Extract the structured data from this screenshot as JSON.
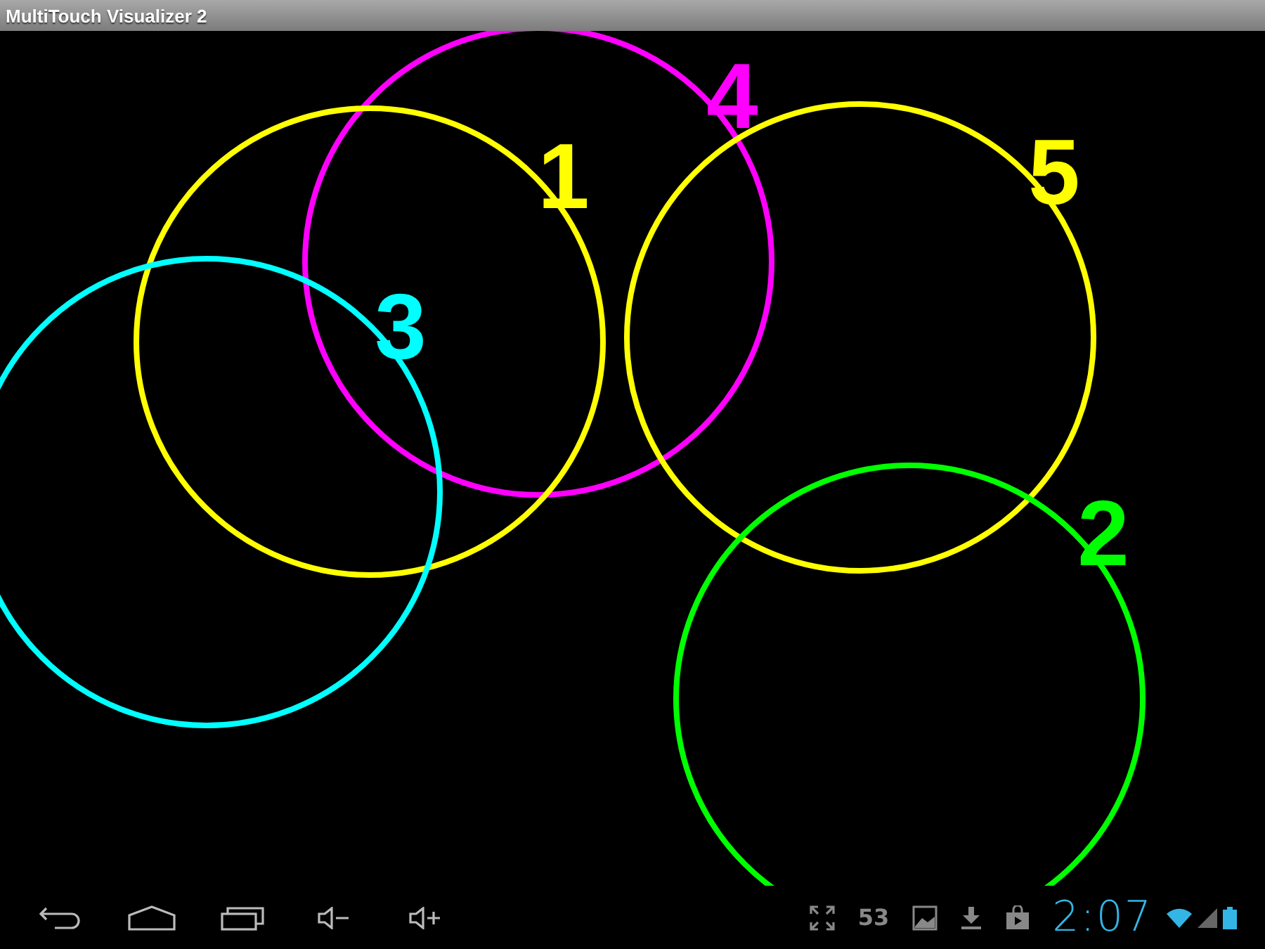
{
  "window": {
    "title": "MultiTouch Visualizer 2"
  },
  "touches": [
    {
      "label": "4",
      "color": "#ff00ff"
    },
    {
      "label": "1",
      "color": "#ffff00"
    },
    {
      "label": "5",
      "color": "#ffff00"
    },
    {
      "label": "3",
      "color": "#00ffff"
    },
    {
      "label": "2",
      "color": "#00ff00"
    }
  ],
  "status_bar": {
    "notification_count": "53",
    "clock": "2:07"
  }
}
